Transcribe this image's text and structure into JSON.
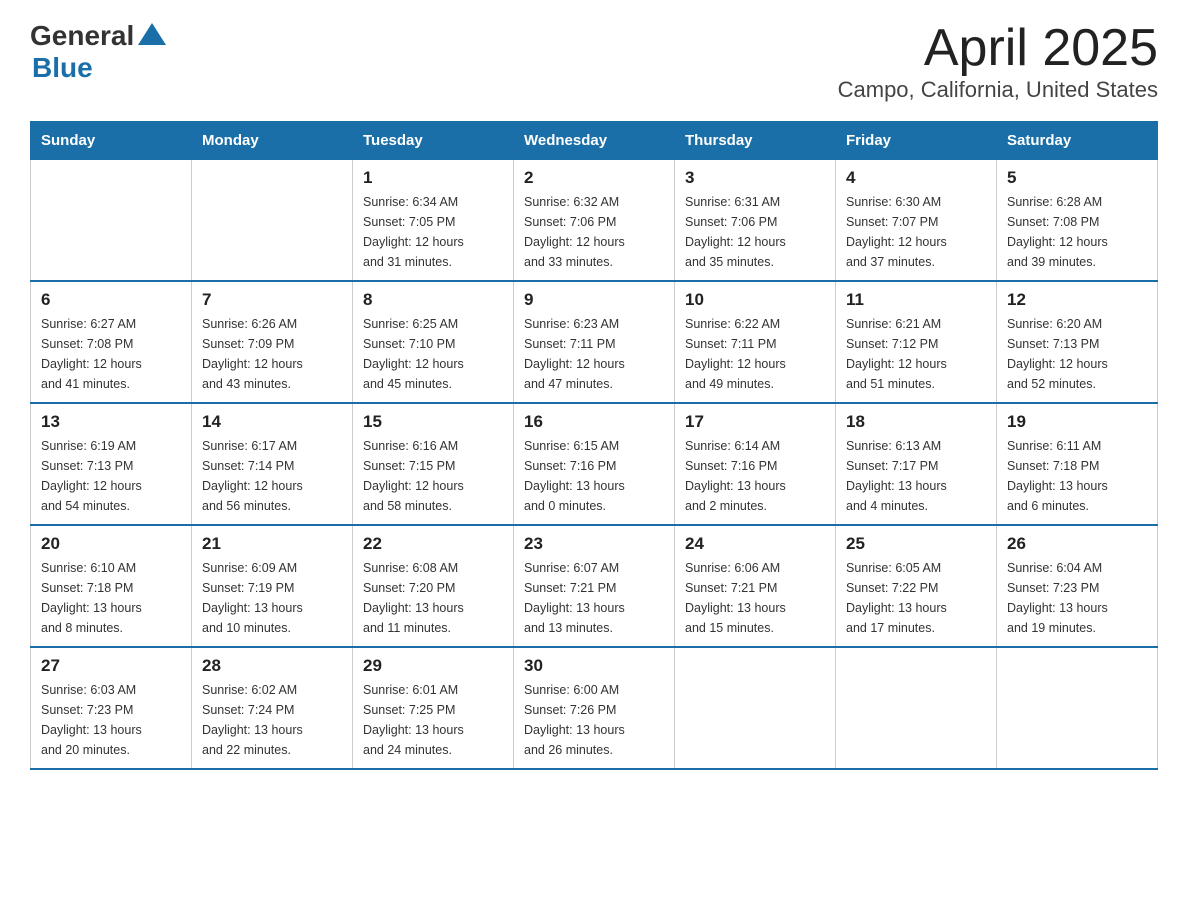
{
  "logo": {
    "text_general": "General",
    "text_blue": "Blue"
  },
  "title": "April 2025",
  "subtitle": "Campo, California, United States",
  "days_of_week": [
    "Sunday",
    "Monday",
    "Tuesday",
    "Wednesday",
    "Thursday",
    "Friday",
    "Saturday"
  ],
  "weeks": [
    [
      {
        "day": "",
        "info": ""
      },
      {
        "day": "",
        "info": ""
      },
      {
        "day": "1",
        "info": "Sunrise: 6:34 AM\nSunset: 7:05 PM\nDaylight: 12 hours\nand 31 minutes."
      },
      {
        "day": "2",
        "info": "Sunrise: 6:32 AM\nSunset: 7:06 PM\nDaylight: 12 hours\nand 33 minutes."
      },
      {
        "day": "3",
        "info": "Sunrise: 6:31 AM\nSunset: 7:06 PM\nDaylight: 12 hours\nand 35 minutes."
      },
      {
        "day": "4",
        "info": "Sunrise: 6:30 AM\nSunset: 7:07 PM\nDaylight: 12 hours\nand 37 minutes."
      },
      {
        "day": "5",
        "info": "Sunrise: 6:28 AM\nSunset: 7:08 PM\nDaylight: 12 hours\nand 39 minutes."
      }
    ],
    [
      {
        "day": "6",
        "info": "Sunrise: 6:27 AM\nSunset: 7:08 PM\nDaylight: 12 hours\nand 41 minutes."
      },
      {
        "day": "7",
        "info": "Sunrise: 6:26 AM\nSunset: 7:09 PM\nDaylight: 12 hours\nand 43 minutes."
      },
      {
        "day": "8",
        "info": "Sunrise: 6:25 AM\nSunset: 7:10 PM\nDaylight: 12 hours\nand 45 minutes."
      },
      {
        "day": "9",
        "info": "Sunrise: 6:23 AM\nSunset: 7:11 PM\nDaylight: 12 hours\nand 47 minutes."
      },
      {
        "day": "10",
        "info": "Sunrise: 6:22 AM\nSunset: 7:11 PM\nDaylight: 12 hours\nand 49 minutes."
      },
      {
        "day": "11",
        "info": "Sunrise: 6:21 AM\nSunset: 7:12 PM\nDaylight: 12 hours\nand 51 minutes."
      },
      {
        "day": "12",
        "info": "Sunrise: 6:20 AM\nSunset: 7:13 PM\nDaylight: 12 hours\nand 52 minutes."
      }
    ],
    [
      {
        "day": "13",
        "info": "Sunrise: 6:19 AM\nSunset: 7:13 PM\nDaylight: 12 hours\nand 54 minutes."
      },
      {
        "day": "14",
        "info": "Sunrise: 6:17 AM\nSunset: 7:14 PM\nDaylight: 12 hours\nand 56 minutes."
      },
      {
        "day": "15",
        "info": "Sunrise: 6:16 AM\nSunset: 7:15 PM\nDaylight: 12 hours\nand 58 minutes."
      },
      {
        "day": "16",
        "info": "Sunrise: 6:15 AM\nSunset: 7:16 PM\nDaylight: 13 hours\nand 0 minutes."
      },
      {
        "day": "17",
        "info": "Sunrise: 6:14 AM\nSunset: 7:16 PM\nDaylight: 13 hours\nand 2 minutes."
      },
      {
        "day": "18",
        "info": "Sunrise: 6:13 AM\nSunset: 7:17 PM\nDaylight: 13 hours\nand 4 minutes."
      },
      {
        "day": "19",
        "info": "Sunrise: 6:11 AM\nSunset: 7:18 PM\nDaylight: 13 hours\nand 6 minutes."
      }
    ],
    [
      {
        "day": "20",
        "info": "Sunrise: 6:10 AM\nSunset: 7:18 PM\nDaylight: 13 hours\nand 8 minutes."
      },
      {
        "day": "21",
        "info": "Sunrise: 6:09 AM\nSunset: 7:19 PM\nDaylight: 13 hours\nand 10 minutes."
      },
      {
        "day": "22",
        "info": "Sunrise: 6:08 AM\nSunset: 7:20 PM\nDaylight: 13 hours\nand 11 minutes."
      },
      {
        "day": "23",
        "info": "Sunrise: 6:07 AM\nSunset: 7:21 PM\nDaylight: 13 hours\nand 13 minutes."
      },
      {
        "day": "24",
        "info": "Sunrise: 6:06 AM\nSunset: 7:21 PM\nDaylight: 13 hours\nand 15 minutes."
      },
      {
        "day": "25",
        "info": "Sunrise: 6:05 AM\nSunset: 7:22 PM\nDaylight: 13 hours\nand 17 minutes."
      },
      {
        "day": "26",
        "info": "Sunrise: 6:04 AM\nSunset: 7:23 PM\nDaylight: 13 hours\nand 19 minutes."
      }
    ],
    [
      {
        "day": "27",
        "info": "Sunrise: 6:03 AM\nSunset: 7:23 PM\nDaylight: 13 hours\nand 20 minutes."
      },
      {
        "day": "28",
        "info": "Sunrise: 6:02 AM\nSunset: 7:24 PM\nDaylight: 13 hours\nand 22 minutes."
      },
      {
        "day": "29",
        "info": "Sunrise: 6:01 AM\nSunset: 7:25 PM\nDaylight: 13 hours\nand 24 minutes."
      },
      {
        "day": "30",
        "info": "Sunrise: 6:00 AM\nSunset: 7:26 PM\nDaylight: 13 hours\nand 26 minutes."
      },
      {
        "day": "",
        "info": ""
      },
      {
        "day": "",
        "info": ""
      },
      {
        "day": "",
        "info": ""
      }
    ]
  ]
}
